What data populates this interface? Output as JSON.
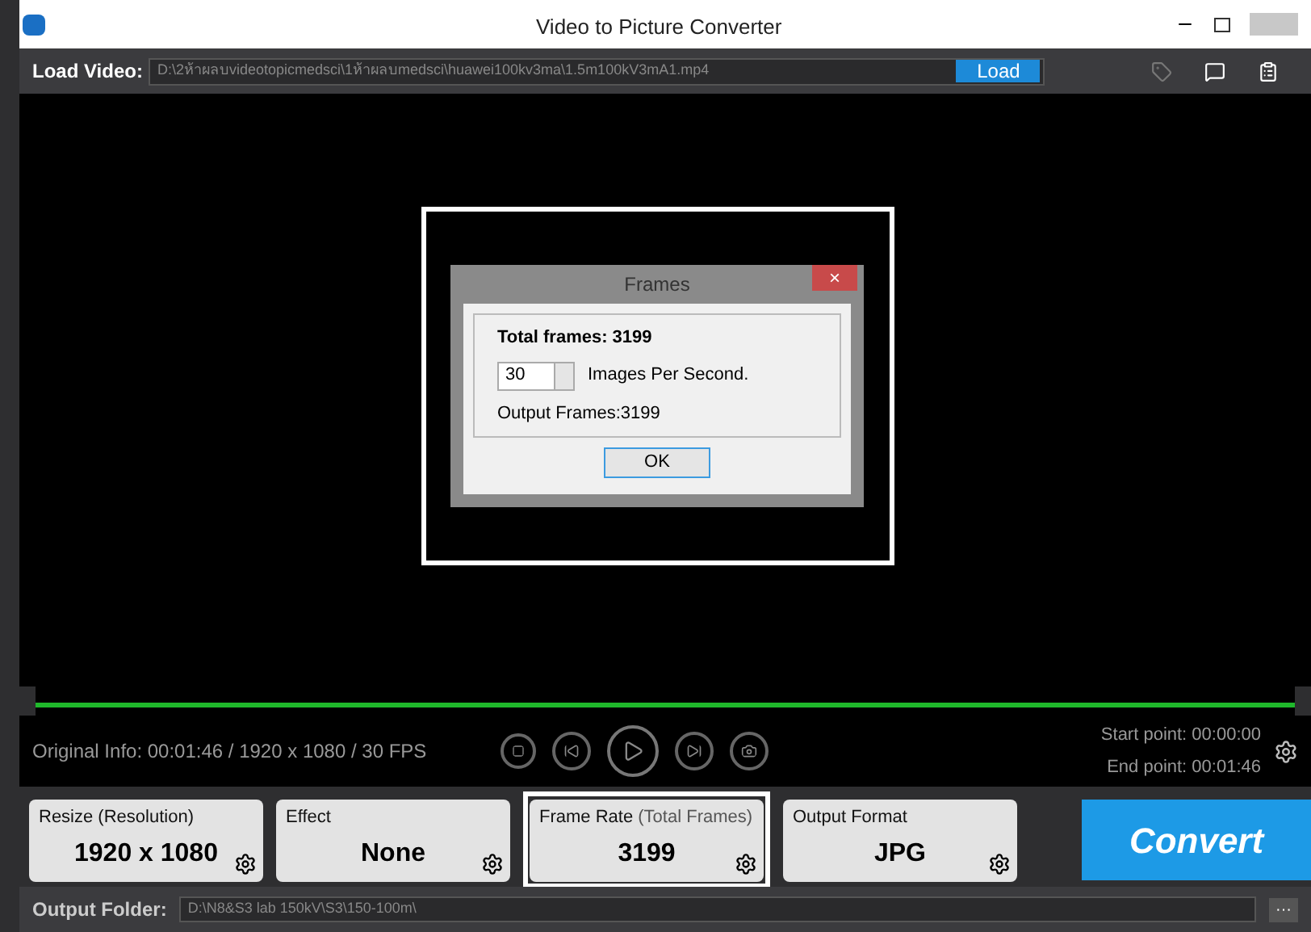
{
  "window": {
    "title": "Video to Picture Converter"
  },
  "load_video": {
    "label": "Load Video:",
    "value": "D:\\2ห้าผลบvideotopicmedsci\\1ห้าผลบmedsci\\huawei100kv3ma\\1.5m100kV3mA1.mp4",
    "button": "Load"
  },
  "dialog": {
    "title": "Frames",
    "close": "×",
    "total_frames": "Total frames: 3199",
    "fps_value": "30",
    "fps_label": "Images Per Second.",
    "output_frames": "Output Frames:3199",
    "ok": "OK"
  },
  "timeline": {
    "level": 1
  },
  "info": "Original Info: 00:01:46 / 1920 x 1080 / 30 FPS",
  "start_point": "Start point: 00:00:00",
  "end_point": "End point: 00:01:46",
  "cards": [
    {
      "label": "Resize (Resolution)",
      "value": "1920 x 1080",
      "highlighted": false
    },
    {
      "label": "Effect",
      "value": "None",
      "highlighted": false
    },
    {
      "label": "Frame Rate",
      "note": "(Total Frames)",
      "value": "3199",
      "highlighted": true
    },
    {
      "label": "Output Format",
      "value": "JPG",
      "highlighted": false
    }
  ],
  "convert": "Convert",
  "output_folder": {
    "label": "Output Folder:",
    "value": "D:\\N8&S3 lab 150kV\\S3\\150-100m\\",
    "more": "···"
  }
}
